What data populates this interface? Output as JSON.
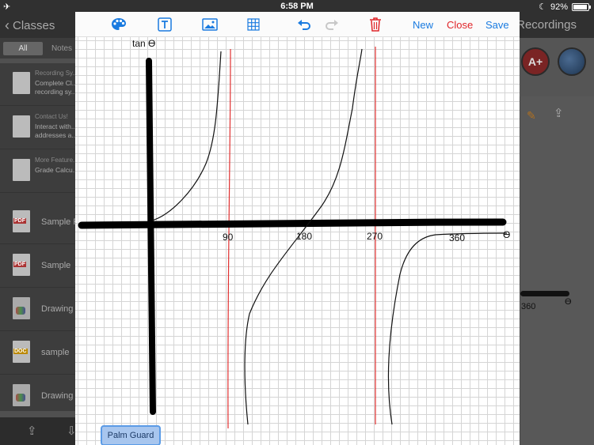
{
  "status_bar": {
    "left_icon": "airplane-icon",
    "time": "6:58 PM",
    "moon_icon": "moon-icon",
    "battery_percent_label": "92%",
    "battery_level": 0.92
  },
  "background_app": {
    "back_label": "Classes",
    "right_title": "Recordings",
    "segments": [
      "All",
      "Notes"
    ],
    "list": [
      {
        "small": "Recording Sy...",
        "line1": "Complete Cl...",
        "line2": "recording sy...",
        "icon": "note"
      },
      {
        "small": "Contact Us!",
        "line1": "Interact with...",
        "line2": "addresses a...",
        "icon": "note"
      },
      {
        "small": "More Feature...",
        "line1": "Grade Calcu...",
        "line2": "",
        "icon": "note"
      },
      {
        "big": "Sample F...",
        "icon": "pdf"
      },
      {
        "big": "Sample",
        "icon": "pdf"
      },
      {
        "big": "Drawing e...",
        "icon": "drawing"
      },
      {
        "big": "sample",
        "icon": "doc"
      },
      {
        "big": "Drawing e...",
        "icon": "drawing"
      }
    ],
    "right_panel": {
      "mini_label": "360",
      "mini_theta": "ϴ"
    }
  },
  "drawing_sheet": {
    "toolbar": {
      "tools": [
        {
          "name": "palette-icon",
          "color": "#1a7be0"
        },
        {
          "name": "text-tool-icon",
          "color": "#1a7be0"
        },
        {
          "name": "image-icon",
          "color": "#1a7be0"
        },
        {
          "name": "grid-icon",
          "color": "#1a7be0"
        },
        {
          "name": "undo-icon",
          "color": "#1a7be0"
        },
        {
          "name": "redo-icon",
          "color": "#c8c8c8"
        },
        {
          "name": "trash-icon",
          "color": "#e0262a"
        }
      ],
      "new_label": "New",
      "close_label": "Close",
      "save_label": "Save"
    },
    "canvas_labels": {
      "y_axis": "tan ϴ",
      "x_axis": "ϴ",
      "tick_90": "90",
      "tick_180": "180",
      "tick_270": "270",
      "tick_360": "360"
    },
    "colors": {
      "axis": "#000000",
      "curve": "#111111",
      "asymptote": "#e03030"
    },
    "palm_guard_label": "Palm Guard"
  }
}
